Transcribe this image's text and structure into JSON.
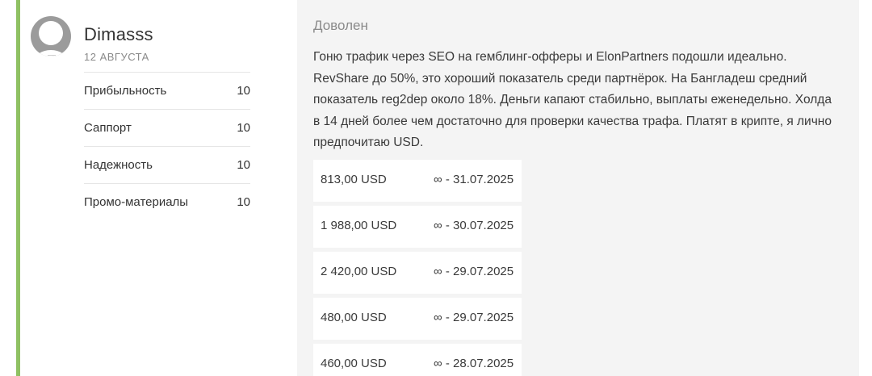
{
  "review": {
    "author": {
      "name": "Dimasss",
      "date": "12 августа"
    },
    "ratings": [
      {
        "label": "Прибыльность",
        "value": "10"
      },
      {
        "label": "Саппорт",
        "value": "10"
      },
      {
        "label": "Надежность",
        "value": "10"
      },
      {
        "label": "Промо-материалы",
        "value": "10"
      }
    ],
    "title": "Доволен",
    "text": "Гоню трафик через SEO на гемблинг-офферы и ElonPartners подошли идеально. RevShare до 50%, это хороший показатель среди партнёрок. На Бангладеш средний показатель reg2dep около 18%. Деньги капают стабильно, выплаты еженедельно. Холда в 14 дней более чем достаточно для проверки качества трафа. Платят в крипте, я лично предпочитаю USD.",
    "payouts": [
      {
        "amount": "813,00 USD",
        "period": "∞ - 31.07.2025"
      },
      {
        "amount": "1 988,00 USD",
        "period": "∞ - 30.07.2025"
      },
      {
        "amount": "2 420,00 USD",
        "period": "∞ - 29.07.2025"
      },
      {
        "amount": "480,00 USD",
        "period": "∞ - 29.07.2025"
      },
      {
        "amount": "460,00 USD",
        "period": "∞ - 28.07.2025"
      }
    ]
  },
  "colors": {
    "accent": "#8fc163",
    "right_panel_bg": "#f4f4f4"
  }
}
